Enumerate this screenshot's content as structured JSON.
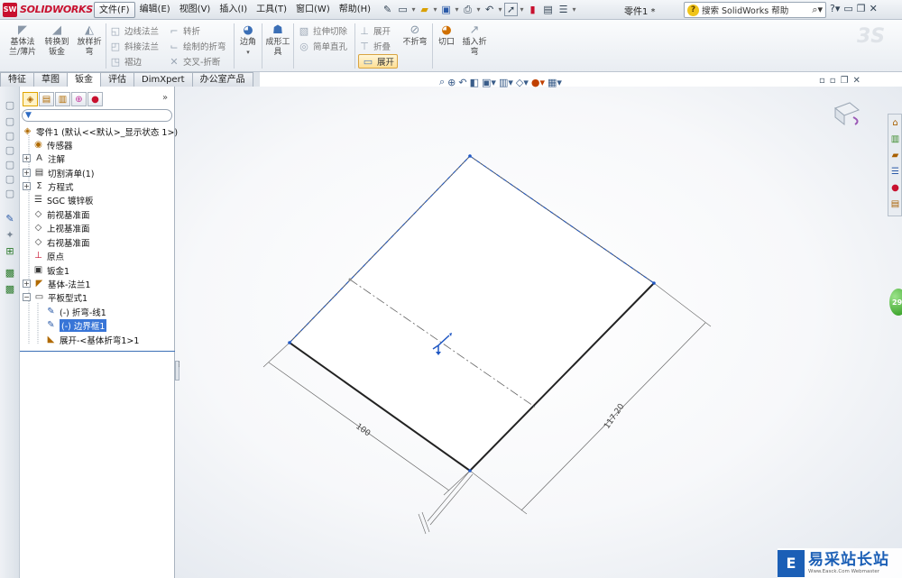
{
  "app": {
    "logo_text": "SOLIDWORKS",
    "doc_title": "零件1 *"
  },
  "menu": [
    "文件(F)",
    "编辑(E)",
    "视图(V)",
    "插入(I)",
    "工具(T)",
    "窗口(W)",
    "帮助(H)"
  ],
  "help_search": {
    "placeholder": "搜索 SolidWorks 帮助",
    "icon": "question-icon"
  },
  "commands": {
    "base_flange": "基体法兰/薄片",
    "convert": "转换到钣金",
    "lofted_bend": "放样折弯",
    "edge_flange": "边线法兰",
    "miter_flange": "斜接法兰",
    "hem": "褶边",
    "jog": "转折",
    "sketched_bend": "绘制的折弯",
    "cross_break": "交叉-折断",
    "corners": "边角",
    "forming_tool": "成形工具",
    "extruded_cut": "拉伸切除",
    "simple_hole": "简单直孔",
    "unfold": "展开",
    "fold": "折叠",
    "flatten": "展开",
    "no_bends": "不折弯",
    "rip": "切口",
    "insert_bends": "插入折弯"
  },
  "tabs": [
    "特征",
    "草图",
    "钣金",
    "评估",
    "DimXpert",
    "办公室产品"
  ],
  "active_tab": "钣金",
  "tree": {
    "root": "零件1 (默认<<默认>_显示状态 1>)",
    "items": [
      "传感器",
      "注解",
      "切割清单(1)",
      "方程式",
      "SGC 镀锌板",
      "前视基准面",
      "上视基准面",
      "右视基准面",
      "原点",
      "钣金1",
      "基体-法兰1",
      "平板型式1",
      "(-) 折弯-线1",
      "(-) 边界框1",
      "展开-<基体折弯1>1"
    ],
    "selected": "(-) 边界框1"
  },
  "dimensions": {
    "width": "100",
    "height": "117.20"
  },
  "watermark": {
    "main": "易采站长站",
    "sub": "Www.Easck.Com  Webmaster"
  },
  "colors": {
    "accent": "#3875d7",
    "brand": "#c8102e",
    "sketch": "#1f57c3"
  }
}
